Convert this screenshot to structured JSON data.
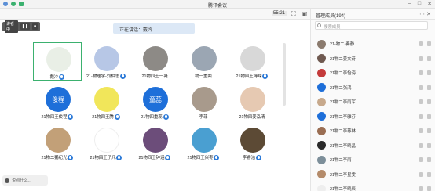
{
  "window": {
    "title": "腾讯会议"
  },
  "topbar": {
    "time": "55:21"
  },
  "stage": {
    "speaking_label": "正在讲话：戴冷",
    "left_tool_label": "讲者中"
  },
  "tiles": [
    {
      "name": "戴冷",
      "color": "#e9efe6"
    },
    {
      "name": "21-物理学-刘相志",
      "color": "#b7c7e6"
    },
    {
      "name": "21物四王一凝",
      "color": "#8d8a86"
    },
    {
      "name": "物一重曲",
      "color": "#9ba6b3"
    },
    {
      "name": "21物四王博嵘",
      "color": "#d8d8d8"
    },
    {
      "name": "21物四王俊程",
      "text": "俊程",
      "color": "#1e6fd9"
    },
    {
      "name": "21物四王腾",
      "color": "#f1e65a"
    },
    {
      "name": "21物四重蕊",
      "text": "童蕊",
      "color": "#1e6fd9"
    },
    {
      "name": "李菲",
      "color": "#a89a8c"
    },
    {
      "name": "21物四姜泓清",
      "color": "#e6c9b2"
    },
    {
      "name": "21物二鹅纪光",
      "color": "#c2a078"
    },
    {
      "name": "21物四王子凡",
      "color": "#ffffff"
    },
    {
      "name": "21物四王钟涵",
      "color": "#6c4d7a"
    },
    {
      "name": "21物四王兴枣",
      "color": "#4a9fd1"
    },
    {
      "name": "李睿洁",
      "color": "#5c4a35"
    }
  ],
  "chat_placeholder": "说点什么...",
  "panel": {
    "title": "管理成员(194)",
    "search_placeholder": "搜索成员",
    "members": [
      {
        "name": "21-物二-秦静",
        "color": "#8b7b6e"
      },
      {
        "name": "21物二姜文诗",
        "color": "#6f5950"
      },
      {
        "name": "21物二李怡海",
        "color": "#c43b3b"
      },
      {
        "name": "21物二张鸿",
        "color": "#1e6fd9"
      },
      {
        "name": "21物二李雨军",
        "color": "#c7a98c"
      },
      {
        "name": "21物二李雅芬",
        "color": "#1e6fd9"
      },
      {
        "name": "21物二李慈林",
        "color": "#9a6e53"
      },
      {
        "name": "21物二李晓晶",
        "color": "#2a2a2a"
      },
      {
        "name": "21物二李雨",
        "color": "#7d8f9a"
      },
      {
        "name": "21物二李星雯",
        "color": "#b48b6a"
      },
      {
        "name": "21物二李晓辰",
        "color": "#eeeeee"
      }
    ]
  }
}
